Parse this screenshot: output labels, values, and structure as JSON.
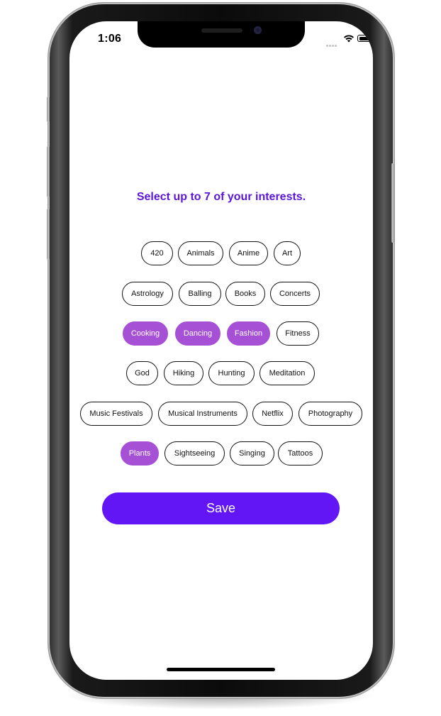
{
  "status_bar": {
    "time": "1:06",
    "icons": [
      "cellular-signal-icon",
      "wifi-icon",
      "battery-icon"
    ]
  },
  "headline": "Select up to 7 of your interests.",
  "interests": [
    {
      "label": "420",
      "selected": false
    },
    {
      "label": "Animals",
      "selected": false
    },
    {
      "label": "Anime",
      "selected": false
    },
    {
      "label": "Art",
      "selected": false
    },
    {
      "label": "Astrology",
      "selected": false
    },
    {
      "label": "Balling",
      "selected": false
    },
    {
      "label": "Books",
      "selected": false
    },
    {
      "label": "Concerts",
      "selected": false
    },
    {
      "label": "Cooking",
      "selected": true
    },
    {
      "label": "Dancing",
      "selected": true
    },
    {
      "label": "Fashion",
      "selected": true
    },
    {
      "label": "Fitness",
      "selected": false
    },
    {
      "label": "God",
      "selected": false
    },
    {
      "label": "Hiking",
      "selected": false
    },
    {
      "label": "Hunting",
      "selected": false
    },
    {
      "label": "Meditation",
      "selected": false
    },
    {
      "label": "Music Festivals",
      "selected": false
    },
    {
      "label": "Musical Instruments",
      "selected": false
    },
    {
      "label": "Netflix",
      "selected": false
    },
    {
      "label": "Photography",
      "selected": false
    },
    {
      "label": "Plants",
      "selected": true
    },
    {
      "label": "Sightseeing",
      "selected": false
    },
    {
      "label": "Singing",
      "selected": false
    },
    {
      "label": "Tattoos",
      "selected": false
    }
  ],
  "save_button": "Save",
  "colors": {
    "accent": "#6216f5",
    "headline": "#5b16d6",
    "selected_chip": "#a650d6"
  }
}
